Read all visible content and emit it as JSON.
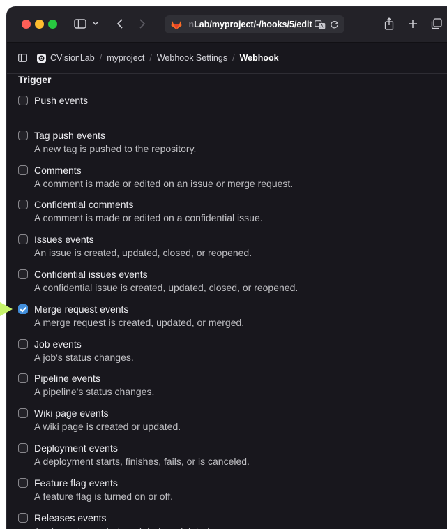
{
  "browser": {
    "url_prefix": "",
    "url_dim": " n",
    "url_main": "Lab/myproject/-/hooks/5/edit"
  },
  "breadcrumb": {
    "items": [
      "CVisionLab",
      "myproject",
      "Webhook Settings"
    ],
    "current": "Webhook"
  },
  "section": {
    "title": "Trigger"
  },
  "events": [
    {
      "label": "Push events",
      "desc": "",
      "checked": false
    },
    {
      "label": "Tag push events",
      "desc": "A new tag is pushed to the repository.",
      "checked": false
    },
    {
      "label": "Comments",
      "desc": "A comment is made or edited on an issue or merge request.",
      "checked": false
    },
    {
      "label": "Confidential comments",
      "desc": "A comment is made or edited on a confidential issue.",
      "checked": false
    },
    {
      "label": "Issues events",
      "desc": "An issue is created, updated, closed, or reopened.",
      "checked": false
    },
    {
      "label": "Confidential issues events",
      "desc": "A confidential issue is created, updated, closed, or reopened.",
      "checked": false
    },
    {
      "label": "Merge request events",
      "desc": "A merge request is created, updated, or merged.",
      "checked": true
    },
    {
      "label": "Job events",
      "desc": "A job's status changes.",
      "checked": false
    },
    {
      "label": "Pipeline events",
      "desc": "A pipeline's status changes.",
      "checked": false
    },
    {
      "label": "Wiki page events",
      "desc": "A wiki page is created or updated.",
      "checked": false
    },
    {
      "label": "Deployment events",
      "desc": "A deployment starts, finishes, fails, or is canceled.",
      "checked": false
    },
    {
      "label": "Feature flag events",
      "desc": "A feature flag is turned on or off.",
      "checked": false
    },
    {
      "label": "Releases events",
      "desc": "A release is created, updated, or deleted.",
      "checked": false
    }
  ],
  "colors": {
    "accent": "#428fdc",
    "pointer": "#c6f36b"
  }
}
